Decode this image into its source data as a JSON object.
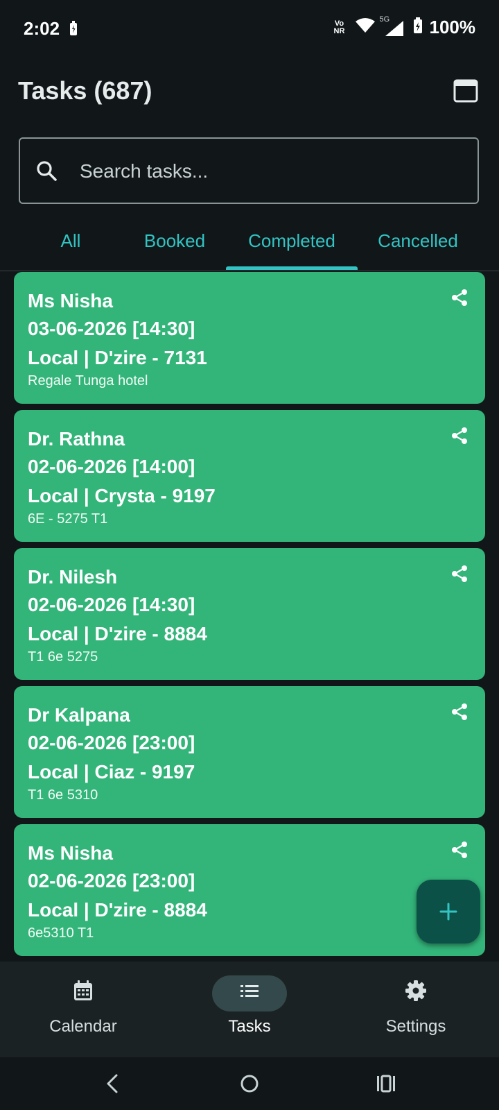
{
  "status": {
    "time": "2:02",
    "volte_top": "Vo",
    "volte_bottom": "NR",
    "network": "5G",
    "battery": "100%"
  },
  "header": {
    "title": "Tasks (687)"
  },
  "search": {
    "placeholder": "Search tasks..."
  },
  "tabs": [
    {
      "label": "All"
    },
    {
      "label": "Booked"
    },
    {
      "label": "Completed",
      "selected": true
    },
    {
      "label": "Cancelled"
    }
  ],
  "tasks": [
    {
      "name": "Ms Nisha",
      "datetime": "03-06-2026 [14:30]",
      "vehicle": "Local | D'zire - 7131",
      "note": "Regale Tunga hotel"
    },
    {
      "name": "Dr. Rathna",
      "datetime": "02-06-2026 [14:00]",
      "vehicle": "Local | Crysta - 9197",
      "note": "6E - 5275 T1"
    },
    {
      "name": "Dr. Nilesh",
      "datetime": "02-06-2026 [14:30]",
      "vehicle": "Local | D'zire - 8884",
      "note": "T1 6e 5275"
    },
    {
      "name": "Dr Kalpana",
      "datetime": "02-06-2026 [23:00]",
      "vehicle": "Local | Ciaz - 9197",
      "note": "T1 6e 5310"
    },
    {
      "name": "Ms Nisha",
      "datetime": "02-06-2026 [23:00]",
      "vehicle": "Local | D'zire - 8884",
      "note": "6e5310 T1"
    }
  ],
  "bottom_nav": [
    {
      "label": "Calendar",
      "icon": "calendar-icon"
    },
    {
      "label": "Tasks",
      "icon": "list-icon",
      "selected": true
    },
    {
      "label": "Settings",
      "icon": "gear-icon"
    }
  ],
  "colors": {
    "accent": "#33c3c3",
    "card": "#33b57a",
    "fab": "#0c5148",
    "background": "#111719"
  }
}
